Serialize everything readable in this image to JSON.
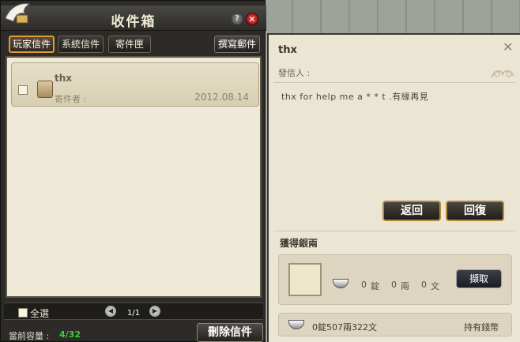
{
  "window": {
    "title": "收件箱",
    "help_label": "?",
    "close_label": "✕"
  },
  "tabs": [
    {
      "label": "玩家信件",
      "active": true
    },
    {
      "label": "系統信件",
      "active": false
    },
    {
      "label": "寄件匣",
      "active": false
    }
  ],
  "write_label": "撰寫郵件",
  "mail_list": [
    {
      "title": "thx",
      "sender_label": "寄件者 :",
      "date": "2012.08.14"
    }
  ],
  "footer": {
    "select_all": "全選",
    "page": "1/1",
    "capacity_label": "當前容量 :",
    "capacity_value": "4/32",
    "delete_label": "刪除信件"
  },
  "detail": {
    "title": "thx",
    "sender_label": "發信人 :",
    "close_label": "✕",
    "body": "thx  for  help  me    a  * * t  .有緣再見",
    "back_label": "返回",
    "reply_label": "回復",
    "reward_title": "獲得銀兩",
    "ding": "0",
    "ding_unit": "錠",
    "liang": "0",
    "liang_unit": "兩",
    "wen": "0",
    "wen_unit": "文",
    "take_label": "擷取",
    "silver_value": "0錠507兩322文",
    "silver_label": "持有錢幣"
  },
  "colors": {
    "accent": "#e09a3a",
    "capacity": "#3ccf39",
    "panel": "#ebe5d3"
  }
}
